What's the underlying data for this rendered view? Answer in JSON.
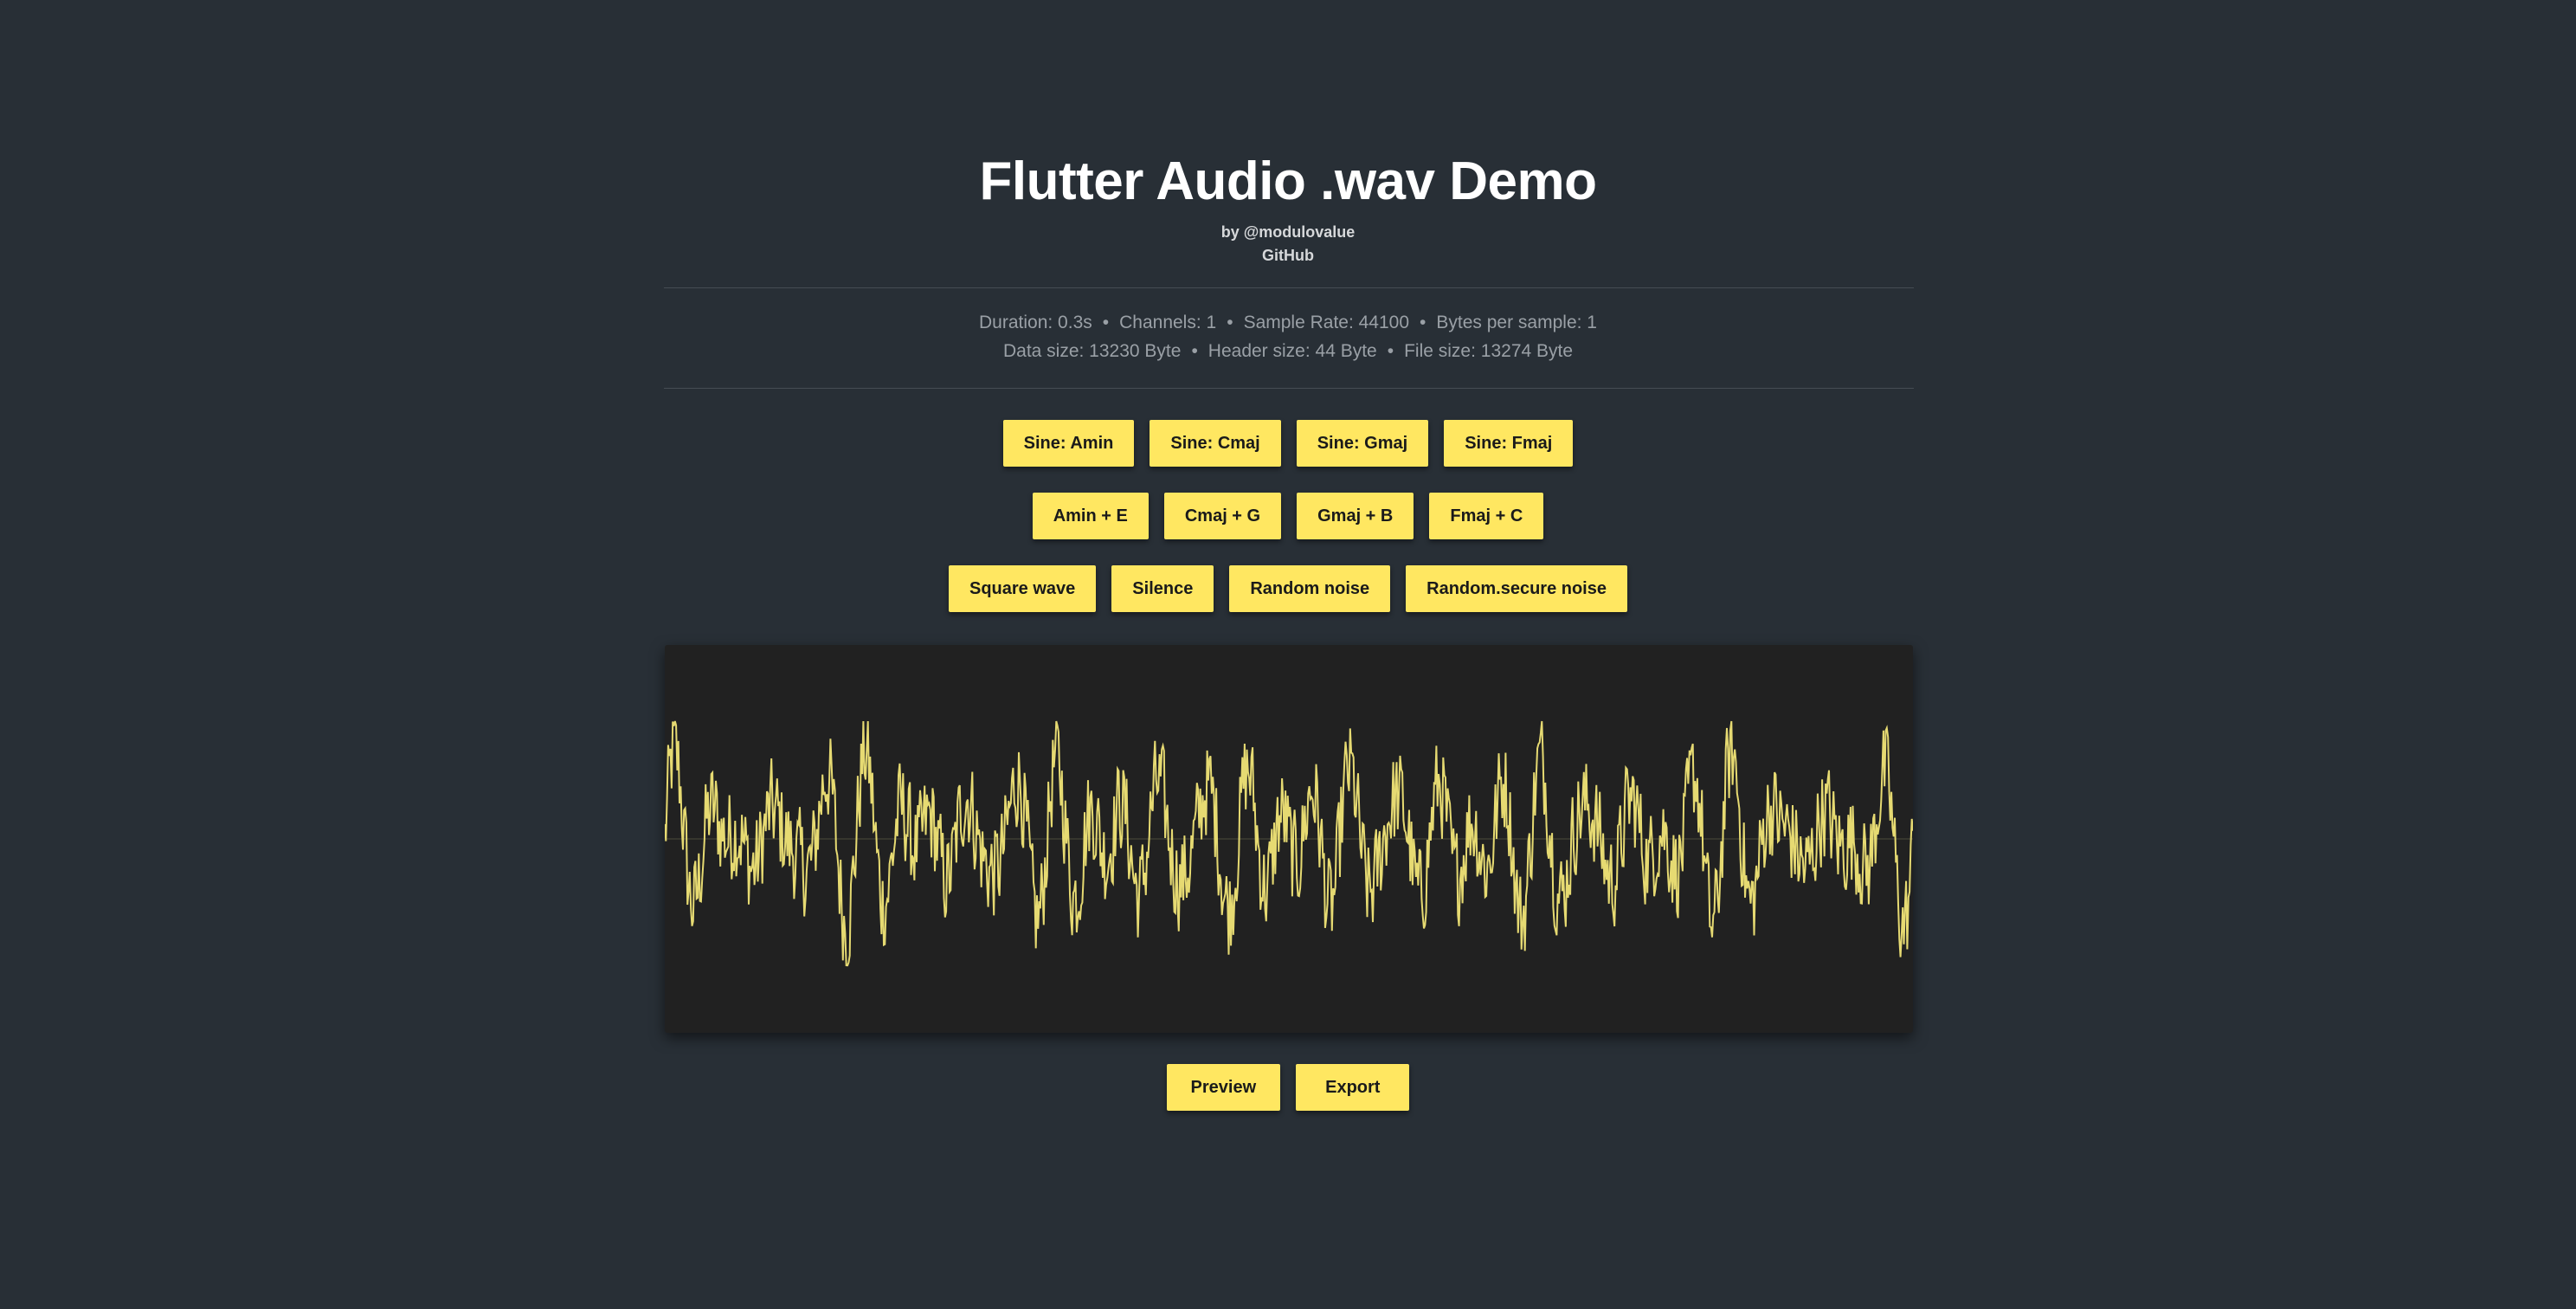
{
  "header": {
    "title": "Flutter Audio .wav Demo",
    "byline": "by @modulovalue",
    "github_link": "GitHub"
  },
  "info": {
    "line1": [
      "Duration: 0.3s",
      "Channels: 1",
      "Sample Rate: 44100",
      "Bytes per sample: 1"
    ],
    "line2": [
      "Data size: 13230 Byte",
      "Header size: 44 Byte",
      "File size: 13274 Byte"
    ],
    "separator": "•"
  },
  "buttons": {
    "row1": [
      "Sine: Amin",
      "Sine: Cmaj",
      "Sine: Gmaj",
      "Sine: Fmaj"
    ],
    "row2": [
      "Amin + E",
      "Cmaj + G",
      "Gmaj + B",
      "Fmaj + C"
    ],
    "row3": [
      "Square wave",
      "Silence",
      "Random noise",
      "Random.secure noise"
    ],
    "actions": [
      "Preview",
      "Export"
    ]
  },
  "waveform": {
    "line_color": "#e6da72",
    "background": "#212121",
    "center_line_color": "#4a4a3a"
  },
  "colors": {
    "page_background": "#282f36",
    "button_background": "#ffe761",
    "button_text": "#1a1a1a",
    "title": "#ffffff",
    "info_text": "#9aa0a6"
  }
}
